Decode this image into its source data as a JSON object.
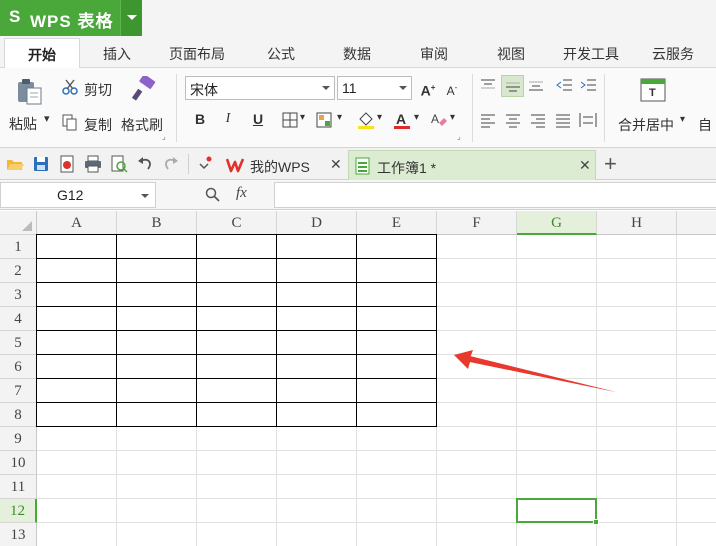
{
  "app": {
    "logo": "S",
    "title": "WPS 表格",
    "accent_color": "#4aa73a"
  },
  "menu_tabs": [
    {
      "label": "开始",
      "active": true
    },
    {
      "label": "插入"
    },
    {
      "label": "页面布局"
    },
    {
      "label": "公式"
    },
    {
      "label": "数据"
    },
    {
      "label": "审阅"
    },
    {
      "label": "视图"
    },
    {
      "label": "开发工具"
    },
    {
      "label": "云服务"
    }
  ],
  "ribbon": {
    "paste_label": "粘贴",
    "cut_label": "剪切",
    "copy_label": "复制",
    "format_painter_label": "格式刷",
    "font_name": "宋体",
    "font_size": "11",
    "bold": "B",
    "italic": "I",
    "underline": "U",
    "merge_label": "合并居中",
    "auto_label": "自"
  },
  "doc_tabs": [
    {
      "label": "我的WPS",
      "icon": "wps-logo-icon"
    },
    {
      "label": "工作簿1 *",
      "icon": "workbook-icon",
      "active": true
    }
  ],
  "formula_bar": {
    "cell_ref": "G12",
    "fx_label": "fx",
    "value": ""
  },
  "grid": {
    "columns": [
      "A",
      "B",
      "C",
      "D",
      "E",
      "F",
      "G",
      "H"
    ],
    "rows": [
      "1",
      "2",
      "3",
      "4",
      "5",
      "6",
      "7",
      "8",
      "9",
      "10",
      "11",
      "12",
      "13"
    ],
    "selected_column": "G",
    "selected_row": "12"
  },
  "annotation": {
    "arrow_color": "#e8392f"
  }
}
